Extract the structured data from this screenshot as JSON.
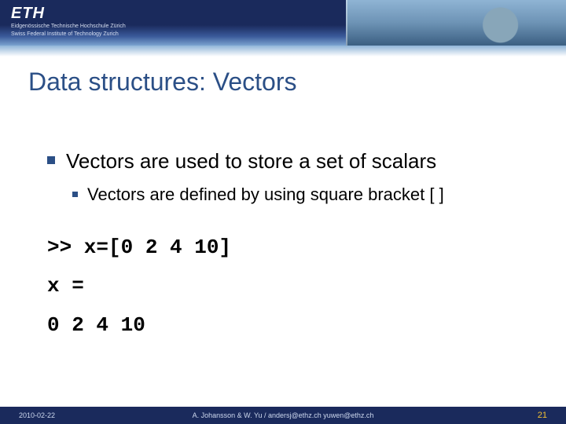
{
  "header": {
    "logo": "ETH",
    "subtitle_de": "Eidgenössische Technische Hochschule Zürich",
    "subtitle_en": "Swiss Federal Institute of Technology Zurich"
  },
  "title": "Data structures: Vectors",
  "bullets": {
    "level1": "Vectors are used to store a set of scalars",
    "level2": "Vectors are defined by using square bracket [ ]"
  },
  "code": {
    "line1": ">> x=[0 2 4 10]",
    "line2": "x =",
    "line3": "0 2 4 10"
  },
  "footer": {
    "date": "2010-02-22",
    "center": "A. Johansson & W. Yu / andersj@ethz.ch yuwen@ethz.ch",
    "page": "21"
  }
}
